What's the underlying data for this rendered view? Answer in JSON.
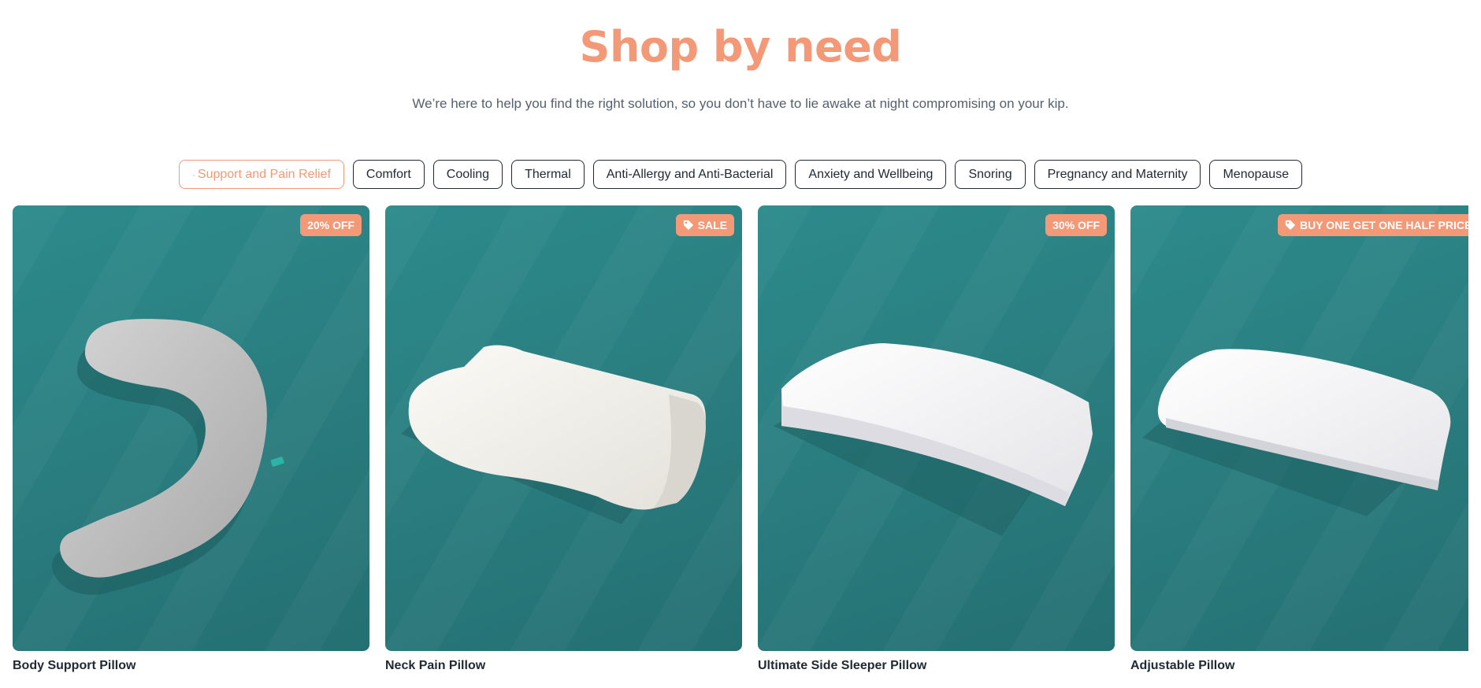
{
  "header": {
    "title": "Shop by need",
    "subtitle": "We’re here to help you find the right solution, so you don’t have to lie awake at night compromising on your kip."
  },
  "filters": [
    {
      "label": "Support and Pain Relief",
      "active": true
    },
    {
      "label": "Comfort",
      "active": false
    },
    {
      "label": "Cooling",
      "active": false
    },
    {
      "label": "Thermal",
      "active": false
    },
    {
      "label": "Anti-Allergy and Anti-Bacterial",
      "active": false
    },
    {
      "label": "Anxiety and Wellbeing",
      "active": false
    },
    {
      "label": "Snoring",
      "active": false
    },
    {
      "label": "Pregnancy and Maternity",
      "active": false
    },
    {
      "label": "Menopause",
      "active": false
    }
  ],
  "products": [
    {
      "name": "Body Support Pillow",
      "badge": "20% OFF",
      "badge_icon": null,
      "image": "body-support-pillow"
    },
    {
      "name": "Neck Pain Pillow",
      "badge": "SALE",
      "badge_icon": "tag-icon",
      "image": "neck-pain-pillow"
    },
    {
      "name": "Ultimate Side Sleeper Pillow",
      "badge": "30% OFF",
      "badge_icon": null,
      "image": "side-sleeper-pillow"
    },
    {
      "name": "Adjustable Pillow",
      "badge": "BUY ONE GET ONE HALF PRICE",
      "badge_icon": "tag-icon",
      "image": "adjustable-pillow"
    }
  ],
  "colors": {
    "accent": "#f49977",
    "card_background": "#2a7d7f",
    "text": "#1f2933"
  }
}
